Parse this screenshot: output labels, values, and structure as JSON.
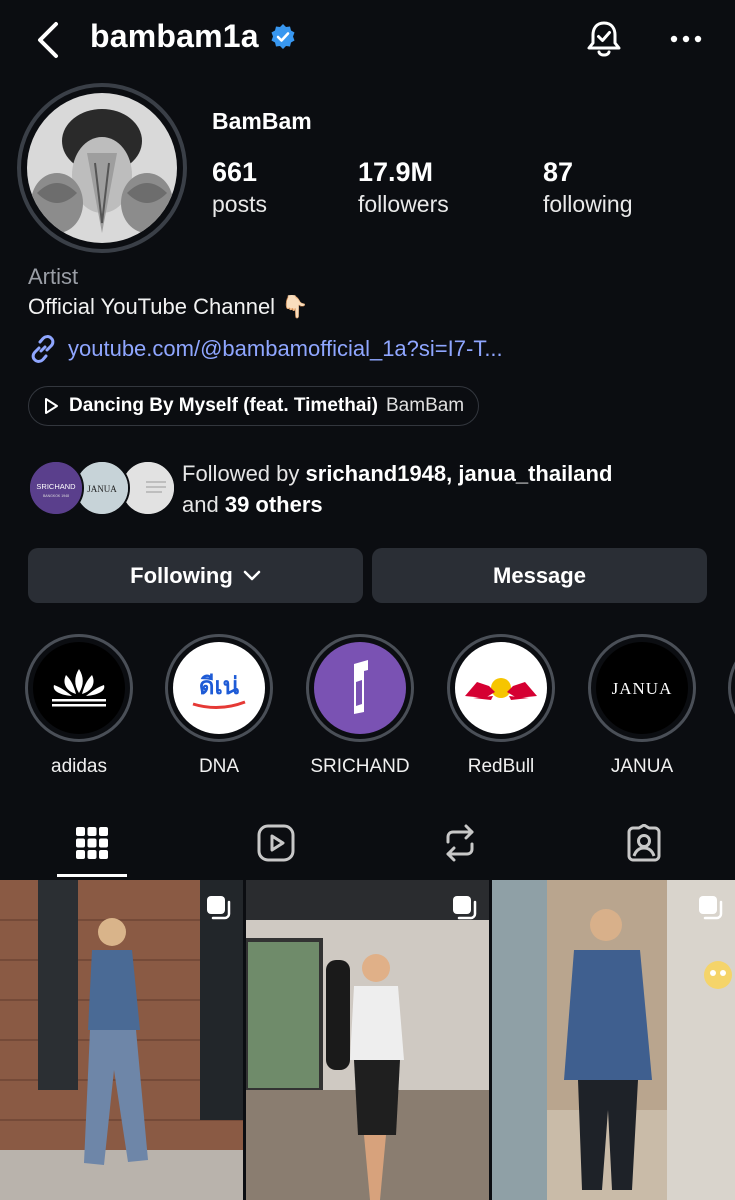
{
  "header": {
    "username": "bambam1a",
    "verified": true,
    "back_icon": "chevron-left-icon",
    "bell_icon": "notification-bell-icon",
    "more_icon": "more-horizontal-icon"
  },
  "profile": {
    "display_name": "BamBam",
    "stats": [
      {
        "value": "661",
        "label": "posts"
      },
      {
        "value": "17.9M",
        "label": "followers"
      },
      {
        "value": "87",
        "label": "following"
      }
    ],
    "category": "Artist",
    "bio": "Official YouTube Channel",
    "bio_emoji": "👇🏻",
    "link": "youtube.com/@bambamofficial_1a?si=I7-T...",
    "music": {
      "title": "Dancing By Myself (feat. Timethai)",
      "artist": "BamBam"
    }
  },
  "followed_by": {
    "prefix": "Followed by ",
    "users": "srichand1948, janua_thailand",
    "conj": "and ",
    "others": "39 others",
    "avatars": [
      {
        "name": "SRICHAND",
        "sub": "BANGKOK 1948",
        "color": "#5a3f8c"
      },
      {
        "name": "JANUA",
        "color": "#cfd8dc"
      },
      {
        "name": "",
        "color": "#dcdcdc"
      }
    ]
  },
  "actions": {
    "following": "Following",
    "message": "Message"
  },
  "highlights": [
    {
      "label": "adidas",
      "bg": "#000000"
    },
    {
      "label": "DNA",
      "bg": "#ffffff",
      "logo_text": "ดีเน่",
      "logo_color": "#1e5bd6"
    },
    {
      "label": "SRICHAND",
      "bg": "#7a52b3"
    },
    {
      "label": "RedBull",
      "bg": "#ffffff"
    },
    {
      "label": "JANUA",
      "bg": "#000000",
      "logo_text": "JANUA"
    }
  ],
  "tabs": [
    {
      "name": "grid",
      "icon": "grid-icon",
      "active": true
    },
    {
      "name": "reels",
      "icon": "reels-icon"
    },
    {
      "name": "reposts",
      "icon": "repost-icon"
    },
    {
      "name": "tagged",
      "icon": "tagged-icon"
    }
  ],
  "colors": {
    "background": "#0b0d11",
    "verified": "#3897f0",
    "link": "#8fa6ff",
    "button": "#2a2e35"
  },
  "posts": [
    {
      "multi": true
    },
    {
      "multi": true
    },
    {
      "multi": true
    }
  ]
}
